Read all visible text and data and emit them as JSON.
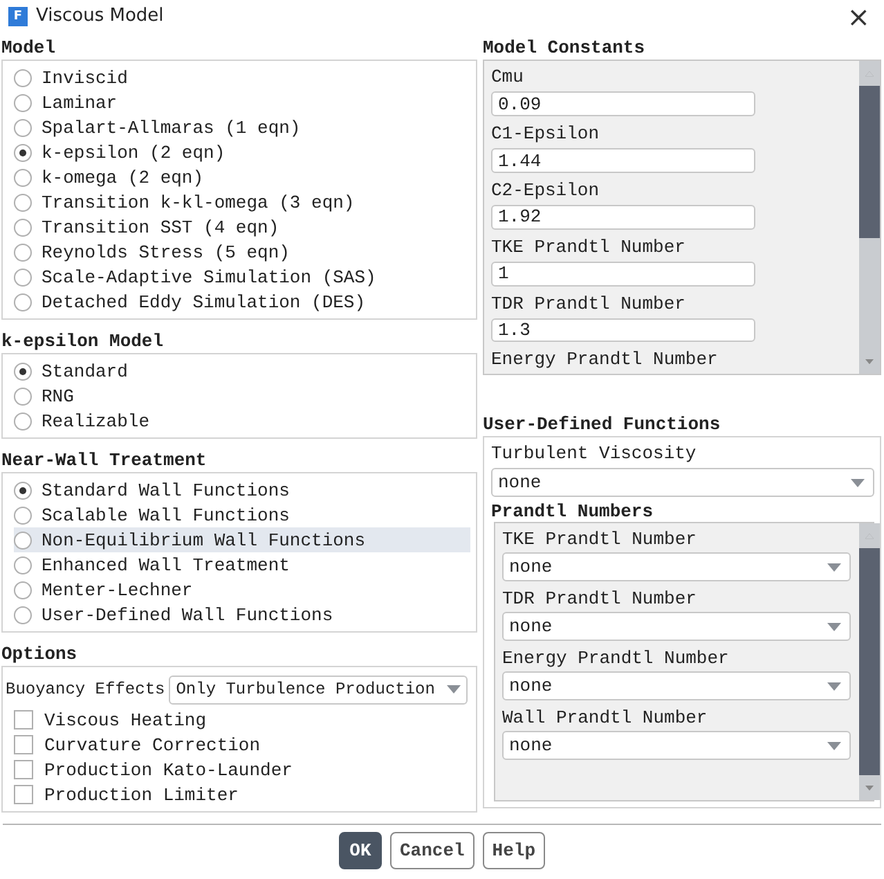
{
  "window": {
    "app_icon_letter": "F",
    "title": "Viscous Model",
    "close": "×"
  },
  "model": {
    "title": "Model",
    "options": [
      {
        "label": "Inviscid",
        "selected": false
      },
      {
        "label": "Laminar",
        "selected": false
      },
      {
        "label": "Spalart-Allmaras (1 eqn)",
        "selected": false
      },
      {
        "label": "k-epsilon (2 eqn)",
        "selected": true
      },
      {
        "label": "k-omega (2 eqn)",
        "selected": false
      },
      {
        "label": "Transition k-kl-omega (3 eqn)",
        "selected": false
      },
      {
        "label": "Transition SST (4 eqn)",
        "selected": false
      },
      {
        "label": "Reynolds Stress (5 eqn)",
        "selected": false
      },
      {
        "label": "Scale-Adaptive Simulation (SAS)",
        "selected": false
      },
      {
        "label": "Detached Eddy Simulation (DES)",
        "selected": false
      }
    ]
  },
  "k_epsilon_model": {
    "title": "k-epsilon Model",
    "options": [
      {
        "label": "Standard",
        "selected": true
      },
      {
        "label": "RNG",
        "selected": false
      },
      {
        "label": "Realizable",
        "selected": false
      }
    ]
  },
  "near_wall_treatment": {
    "title": "Near-Wall Treatment",
    "options": [
      {
        "label": "Standard Wall Functions",
        "selected": true,
        "highlighted": false
      },
      {
        "label": "Scalable Wall Functions",
        "selected": false,
        "highlighted": false
      },
      {
        "label": "Non-Equilibrium Wall Functions",
        "selected": false,
        "highlighted": true
      },
      {
        "label": "Enhanced Wall Treatment",
        "selected": false,
        "highlighted": false
      },
      {
        "label": "Menter-Lechner",
        "selected": false,
        "highlighted": false
      },
      {
        "label": "User-Defined Wall Functions",
        "selected": false,
        "highlighted": false
      }
    ]
  },
  "options": {
    "title": "Options",
    "buoyancy": {
      "label": "Buoyancy Effects",
      "value": "Only Turbulence Production"
    },
    "checkboxes": [
      {
        "label": "Viscous Heating",
        "checked": false
      },
      {
        "label": "Curvature Correction",
        "checked": false
      },
      {
        "label": "Production Kato-Launder",
        "checked": false
      },
      {
        "label": "Production Limiter",
        "checked": false
      }
    ]
  },
  "model_constants": {
    "title": "Model Constants",
    "fields": [
      {
        "label": "Cmu",
        "value": "0.09"
      },
      {
        "label": "C1-Epsilon",
        "value": "1.44"
      },
      {
        "label": "C2-Epsilon",
        "value": "1.92"
      },
      {
        "label": "TKE Prandtl Number",
        "value": "1"
      },
      {
        "label": "TDR Prandtl Number",
        "value": "1.3"
      },
      {
        "label": "Energy Prandtl Number"
      }
    ]
  },
  "user_defined_functions": {
    "title": "User-Defined Functions",
    "turbulent_viscosity": {
      "label": "Turbulent Viscosity",
      "value": "none"
    },
    "prandtl_numbers": {
      "title": "Prandtl Numbers",
      "fields": [
        {
          "label": "TKE Prandtl Number",
          "value": "none"
        },
        {
          "label": "TDR Prandtl Number",
          "value": "none"
        },
        {
          "label": "Energy Prandtl Number",
          "value": "none"
        },
        {
          "label": "Wall Prandtl Number",
          "value": "none"
        }
      ]
    }
  },
  "buttons": [
    {
      "label": "OK",
      "default": true
    },
    {
      "label": "Cancel",
      "default": false
    },
    {
      "label": "Help",
      "default": false
    }
  ]
}
